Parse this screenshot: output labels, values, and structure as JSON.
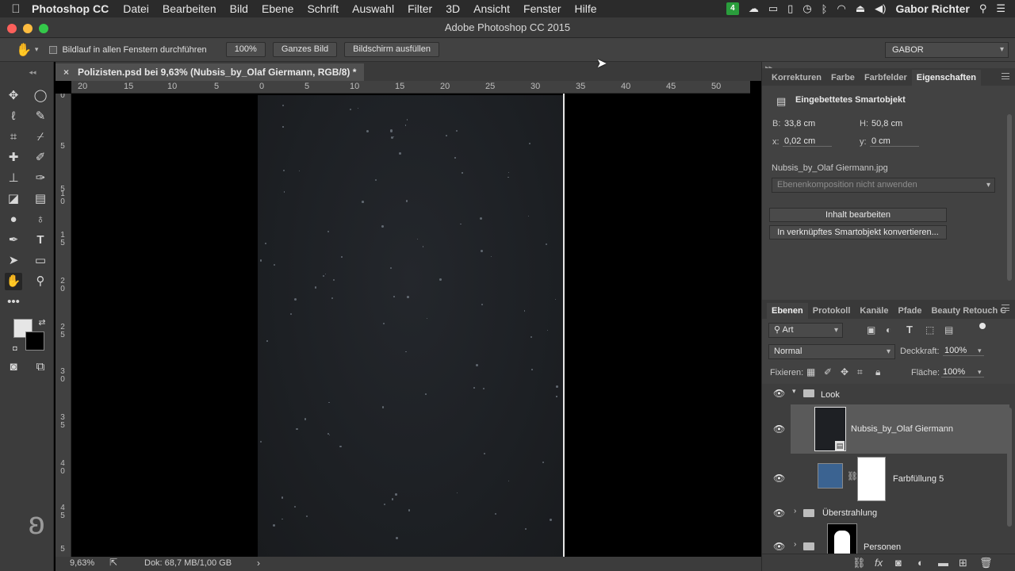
{
  "menubar": {
    "apple": "",
    "app": "Photoshop CC",
    "items": [
      "Datei",
      "Bearbeiten",
      "Bild",
      "Ebene",
      "Schrift",
      "Auswahl",
      "Filter",
      "3D",
      "Ansicht",
      "Fenster",
      "Hilfe"
    ],
    "badge": "4",
    "user": "Gabor Richter"
  },
  "window": {
    "title": "Adobe Photoshop CC 2015"
  },
  "options": {
    "scroll_all_label": "Bildlauf in allen Fenstern durchführen",
    "zoom_btn": "100%",
    "fit_btn": "Ganzes Bild",
    "fill_btn": "Bildschirm ausfüllen",
    "workspace": "GABOR"
  },
  "document": {
    "tab_title": "Polizisten.psd bei 9,63% (Nubsis_by_Olaf Giermann, RGB/8) *",
    "close": "×",
    "hruler": [
      "20",
      "15",
      "10",
      "5",
      "0",
      "5",
      "10",
      "15",
      "20",
      "25",
      "30",
      "35",
      "40",
      "45",
      "50"
    ],
    "vruler": [
      "5",
      "0",
      "5",
      "1\n0",
      "1\n5",
      "2\n0",
      "2\n5",
      "3\n0",
      "3\n5",
      "4\n0",
      "4\n5",
      "5"
    ]
  },
  "status": {
    "zoom": "9,63%",
    "doc": "Dok: 68,7 MB/1,00 GB",
    "arrow": "›"
  },
  "properties_panel": {
    "tabs": [
      "Korrekturen",
      "Farbe",
      "Farbfelder",
      "Eigenschaften"
    ],
    "active_tab": 3,
    "header": "Eingebettetes Smartobjekt",
    "w_label": "B:",
    "w_value": "33,8 cm",
    "h_label": "H:",
    "h_value": "50,8 cm",
    "x_label": "x:",
    "x_value": "0,02 cm",
    "y_label": "y:",
    "y_value": "0 cm",
    "file": "Nubsis_by_Olaf Giermann.jpg",
    "comp_dropdown": "Ebenenkomposition nicht anwenden",
    "edit_btn": "Inhalt bearbeiten",
    "convert_btn": "In verknüpftes Smartobjekt konvertieren..."
  },
  "layers_panel": {
    "tabs": [
      "Ebenen",
      "Protokoll",
      "Kanäle",
      "Pfade",
      "Beauty Retouch C"
    ],
    "filter": "Art",
    "blend_mode": "Normal",
    "opacity_label": "Deckkraft:",
    "opacity": "100%",
    "lock_label": "Fixieren:",
    "fill_label": "Fläche:",
    "fill": "100%",
    "layers": [
      {
        "name": "Look",
        "type": "group",
        "expanded": true
      },
      {
        "name": "Nubsis_by_Olaf Giermann",
        "type": "smart",
        "selected": true
      },
      {
        "name": "Farbfüllung 5",
        "type": "fill"
      },
      {
        "name": "Überstrahlung",
        "type": "group",
        "expanded": false
      },
      {
        "name": "Personen",
        "type": "group",
        "expanded": false
      }
    ]
  },
  "colors": {
    "accent_blue": "#3d6a9a",
    "fill_swatch": "#3b6391",
    "foreground": "#e6e6e6",
    "background": "#000000"
  }
}
